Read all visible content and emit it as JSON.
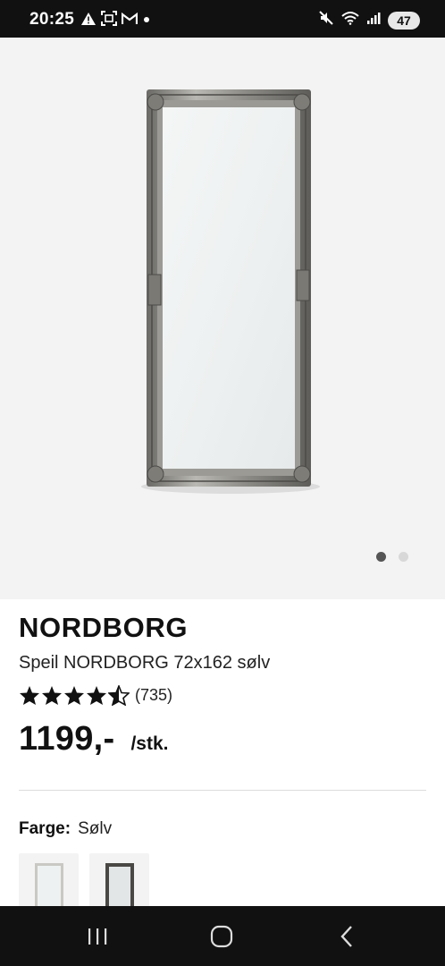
{
  "status_bar": {
    "time": "20:25",
    "battery": "47",
    "left_icons": [
      "warning-icon",
      "screenshot-icon",
      "gmail-icon",
      "dot-icon"
    ],
    "right_icons": [
      "mute-icon",
      "wifi-icon",
      "signal-icon",
      "battery-icon"
    ]
  },
  "gallery": {
    "image": "mirror-image",
    "dots": 2,
    "active_dot": 0
  },
  "product": {
    "brand": "NORDBORG",
    "name": "Speil NORDBORG 72x162 sølv",
    "rating": 4.5,
    "review_count": "(735)",
    "price": "1199,-",
    "unit": "/stk."
  },
  "color": {
    "label": "Farge:",
    "value": "Sølv",
    "variants": [
      "silver-mirror-thumbnail",
      "dark-mirror-thumbnail"
    ]
  },
  "colors": {
    "status_bar_bg": "#111111",
    "image_bg": "#f3f3f3",
    "active_dot": "#555555",
    "inactive_dot": "#d8d8d8"
  },
  "nav_bar": {
    "buttons": [
      "recent-apps-icon",
      "home-icon",
      "back-icon"
    ]
  }
}
